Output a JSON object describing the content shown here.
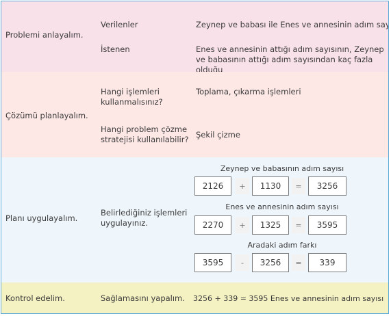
{
  "rows": [
    {
      "step": "Problemi anlayalım.",
      "items": [
        {
          "question": "Verilenler",
          "answer": "Zeynep ve babası ile Enes ve annesinin adım sayısı"
        },
        {
          "question": "İstenen",
          "answer": "Enes ve annesinin attığı adım sayısının, Zeynep ve babasının attığı adım sayısından kaç fazla olduğu"
        }
      ]
    },
    {
      "step": "Çözümü planlayalım.",
      "items": [
        {
          "question": "Hangi işlemleri kullanmalısınız?",
          "answer": "Toplama, çıkarma işlemleri"
        },
        {
          "question": "Hangi problem çözme stratejisi kullanılabilir?",
          "answer": "Şekil çizme"
        }
      ]
    },
    {
      "step": "Planı uygulayalım.",
      "items": [
        {
          "question": "Belirlediğiniz işlemleri uygulayınız."
        }
      ],
      "equations": [
        {
          "heading": "Zeynep ve babasının adım sayısı",
          "a": "2126",
          "op": "+",
          "b": "1130",
          "eq": "=",
          "result": "3256"
        },
        {
          "heading": "Enes ve annesinin adım sayısı",
          "a": "2270",
          "op": "+",
          "b": "1325",
          "eq": "=",
          "result": "3595"
        },
        {
          "heading": "Aradaki adım farkı",
          "a": "3595",
          "op": "-",
          "b": "3256",
          "eq": "=",
          "result": "339"
        }
      ]
    },
    {
      "step": "Kontrol edelim.",
      "items": [
        {
          "question": "Sağlamasını yapalım.",
          "answer": "3256 + 339 = 3595 Enes ve annesinin adım sayısı"
        }
      ]
    }
  ]
}
